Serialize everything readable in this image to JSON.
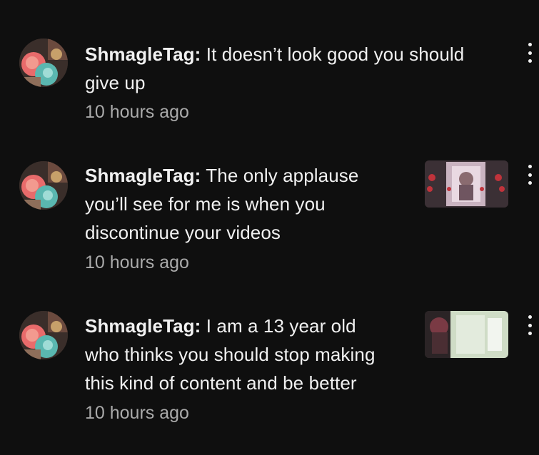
{
  "notifications": [
    {
      "user": "ShmagleTag:",
      "message_lines": [
        "It doesn’t look good you should",
        "give up"
      ],
      "time": "10 hours ago",
      "has_thumbnail": false
    },
    {
      "user": "ShmagleTag:",
      "message_lines": [
        "The only applause",
        "you’ll see for me is when you",
        "discontinue your videos"
      ],
      "time": "10 hours ago",
      "has_thumbnail": true
    },
    {
      "user": "ShmagleTag:",
      "message_lines": [
        "I am a 13 year old",
        "who thinks you should stop making",
        "this kind of content and be better"
      ],
      "time": "10 hours ago",
      "has_thumbnail": true
    }
  ],
  "icons": {
    "menu": "more-vert-icon"
  },
  "colors": {
    "background": "#0f0f0f",
    "text": "#f1f1f1",
    "secondary_text": "#aaaaaa"
  }
}
